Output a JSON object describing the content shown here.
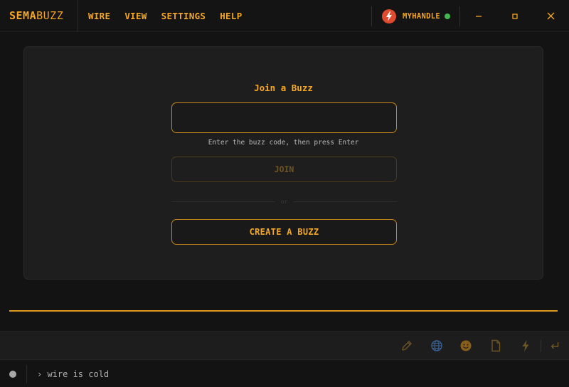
{
  "app": {
    "brand_part1": "SEMA",
    "brand_part2": "BUZZ"
  },
  "menu": {
    "items": [
      {
        "label": "WIRE"
      },
      {
        "label": "VIEW"
      },
      {
        "label": "SETTINGS"
      },
      {
        "label": "HELP"
      }
    ]
  },
  "user": {
    "handle": "MYHANDLE",
    "status": "online",
    "avatar_icon": "lightning-bolt-icon"
  },
  "window_controls": [
    "minimize-icon",
    "maximize-icon",
    "close-icon"
  ],
  "join": {
    "title": "Join a Buzz",
    "input_value": "",
    "hint": "Enter the buzz code, then press Enter",
    "join_label": "JOIN",
    "join_disabled": true,
    "divider_text": "or",
    "create_label": "CREATE A BUZZ"
  },
  "toolbar": {
    "tools": [
      "pencil-icon",
      "globe-icon",
      "emoji-icon",
      "file-icon",
      "lightning-icon",
      "enter-icon"
    ]
  },
  "status": {
    "text": "› wire is cold"
  },
  "colors": {
    "accent": "#f5a623",
    "background": "#131313",
    "panel": "#1e1e1e",
    "online": "#3fb950",
    "avatar": "#e04a2f"
  }
}
